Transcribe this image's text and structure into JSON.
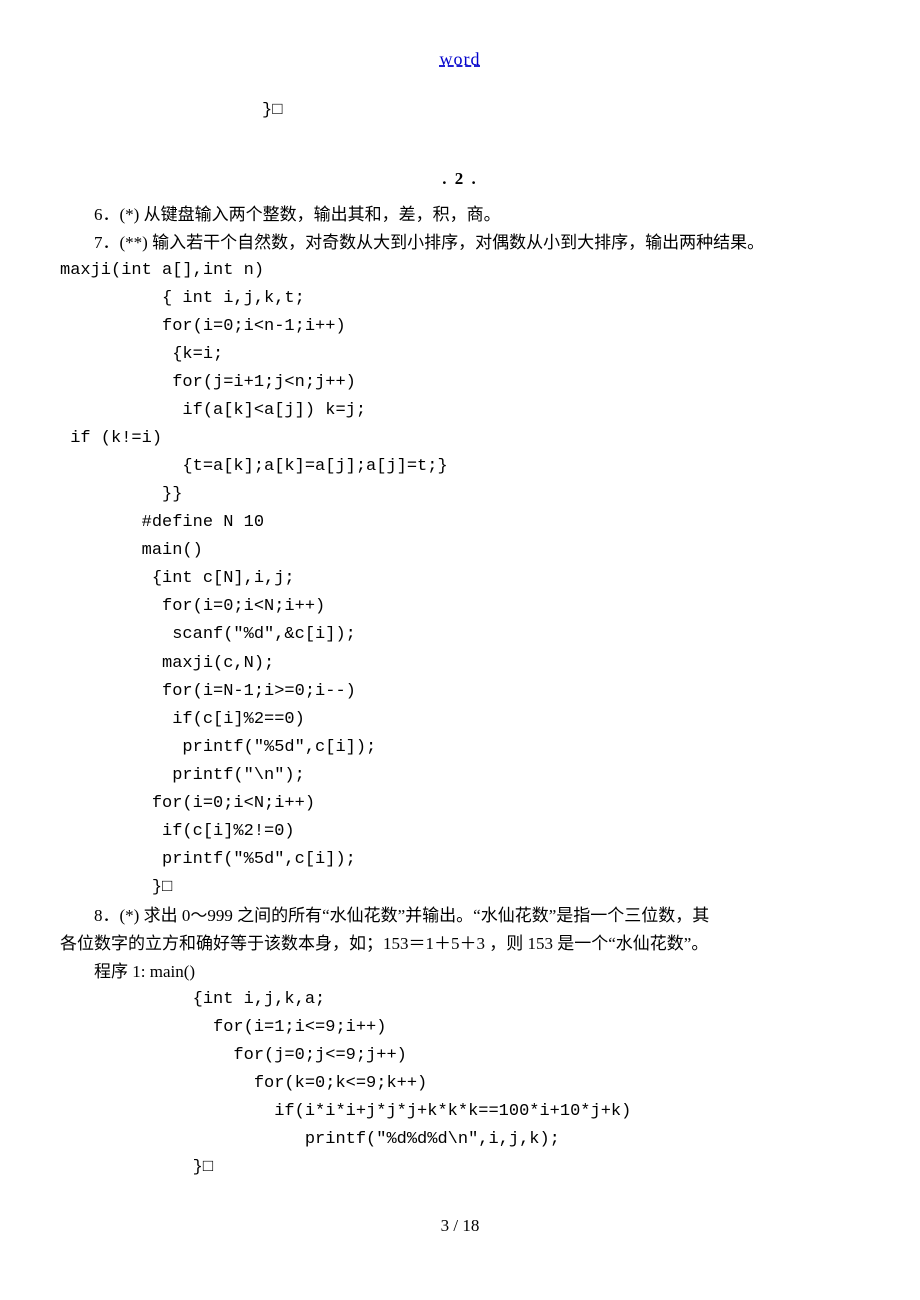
{
  "header": "word",
  "top_code": "          }",
  "section": ". 2 .",
  "q6": "6．(*) 从键盘输入两个整数，输出其和，差，积，商。",
  "q7": "7．(**) 输入若干个自然数，对奇数从大到小排序，对偶数从小到大排序，输出两种结果。",
  "code7": {
    "l01": "maxji(int a[],int n)",
    "l02": "          { int i,j,k,t;",
    "l03": "          for(i=0;i<n-1;i++)",
    "l04": "           {k=i;",
    "l05": "           for(j=i+1;j<n;j++)",
    "l06": "            if(a[k]<a[j]) k=j;",
    "l07": " if (k!=i)",
    "l08": "            {t=a[k];a[k]=a[j];a[j]=t;}",
    "l09": "          }}",
    "l10": "        #define N 10",
    "l11": "        main()",
    "l12": "         {int c[N],i,j;",
    "l13": "          for(i=0;i<N;i++)",
    "l14": "           scanf(\"%d\",&c[i]);",
    "l15": "          maxji(c,N);",
    "l16": "          for(i=N-1;i>=0;i--)",
    "l17": "           if(c[i]%2==0)",
    "l18": "            printf(\"%5d\",c[i]);",
    "l19": "           printf(\"\\n\");",
    "l20": "         for(i=0;i<N;i++)",
    "l21": "          if(c[i]%2!=0)",
    "l22": "          printf(\"%5d\",c[i]);",
    "l23": "         }"
  },
  "q8a": "8．(*) 求出 0～999 之间的所有“水仙花数”并输出。“水仙花数”是指一个三位数，其",
  "q8b": "各位数字的立方和确好等于该数本身，如；153＝1＋5＋3 ，则 153 是一个“水仙花数”。",
  "prog1_label": "程序 1:    main()",
  "code8": {
    "l01": "             {int i,j,k,a;",
    "l02": "               for(i=1;i<=9;i++)",
    "l03": "                 for(j=0;j<=9;j++)",
    "l04": "                   for(k=0;k<=9;k++)",
    "l05": "                     if(i*i*i+j*j*j+k*k*k==100*i+10*j+k)",
    "l06": "                        printf(\"%d%d%d\\n\",i,j,k);",
    "l07": "             }"
  },
  "footer": "3 / 18"
}
